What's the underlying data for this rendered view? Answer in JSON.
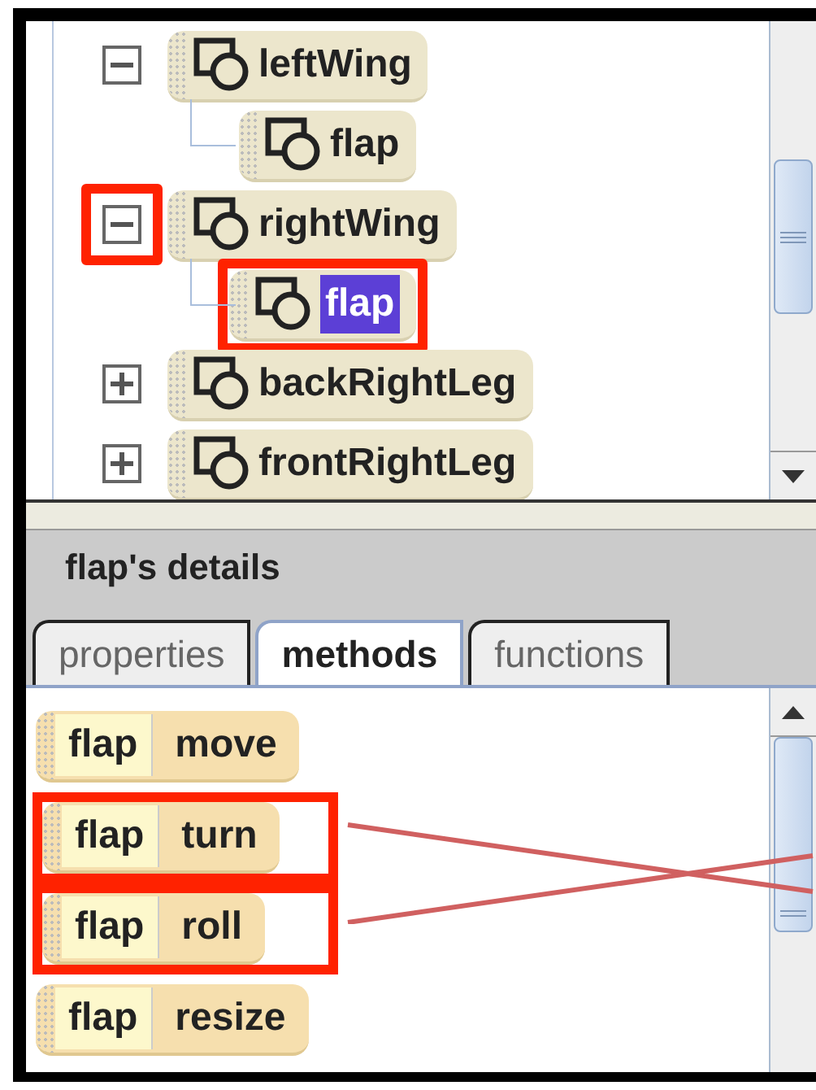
{
  "tree": [
    {
      "label": "leftWing",
      "expanded": true,
      "toggle_highlighted": false,
      "selected": false,
      "children": [
        {
          "label": "flap",
          "highlighted": false,
          "selected": false
        }
      ]
    },
    {
      "label": "rightWing",
      "expanded": true,
      "toggle_highlighted": true,
      "selected": false,
      "children": [
        {
          "label": "flap",
          "highlighted": true,
          "selected": true
        }
      ]
    },
    {
      "label": "backRightLeg",
      "expanded": false,
      "toggle_highlighted": false,
      "selected": false
    },
    {
      "label": "frontRightLeg",
      "expanded": false,
      "toggle_highlighted": false,
      "selected": false
    }
  ],
  "details": {
    "title": "flap's details",
    "tabs": [
      {
        "label": "properties",
        "selected": false
      },
      {
        "label": "methods",
        "selected": true
      },
      {
        "label": "functions",
        "selected": false
      }
    ],
    "methods": [
      {
        "object": "flap",
        "method": "move",
        "highlighted": false
      },
      {
        "object": "flap",
        "method": "turn",
        "highlighted": true
      },
      {
        "object": "flap",
        "method": "roll",
        "highlighted": true
      },
      {
        "object": "flap",
        "method": "resize",
        "highlighted": false
      }
    ]
  }
}
